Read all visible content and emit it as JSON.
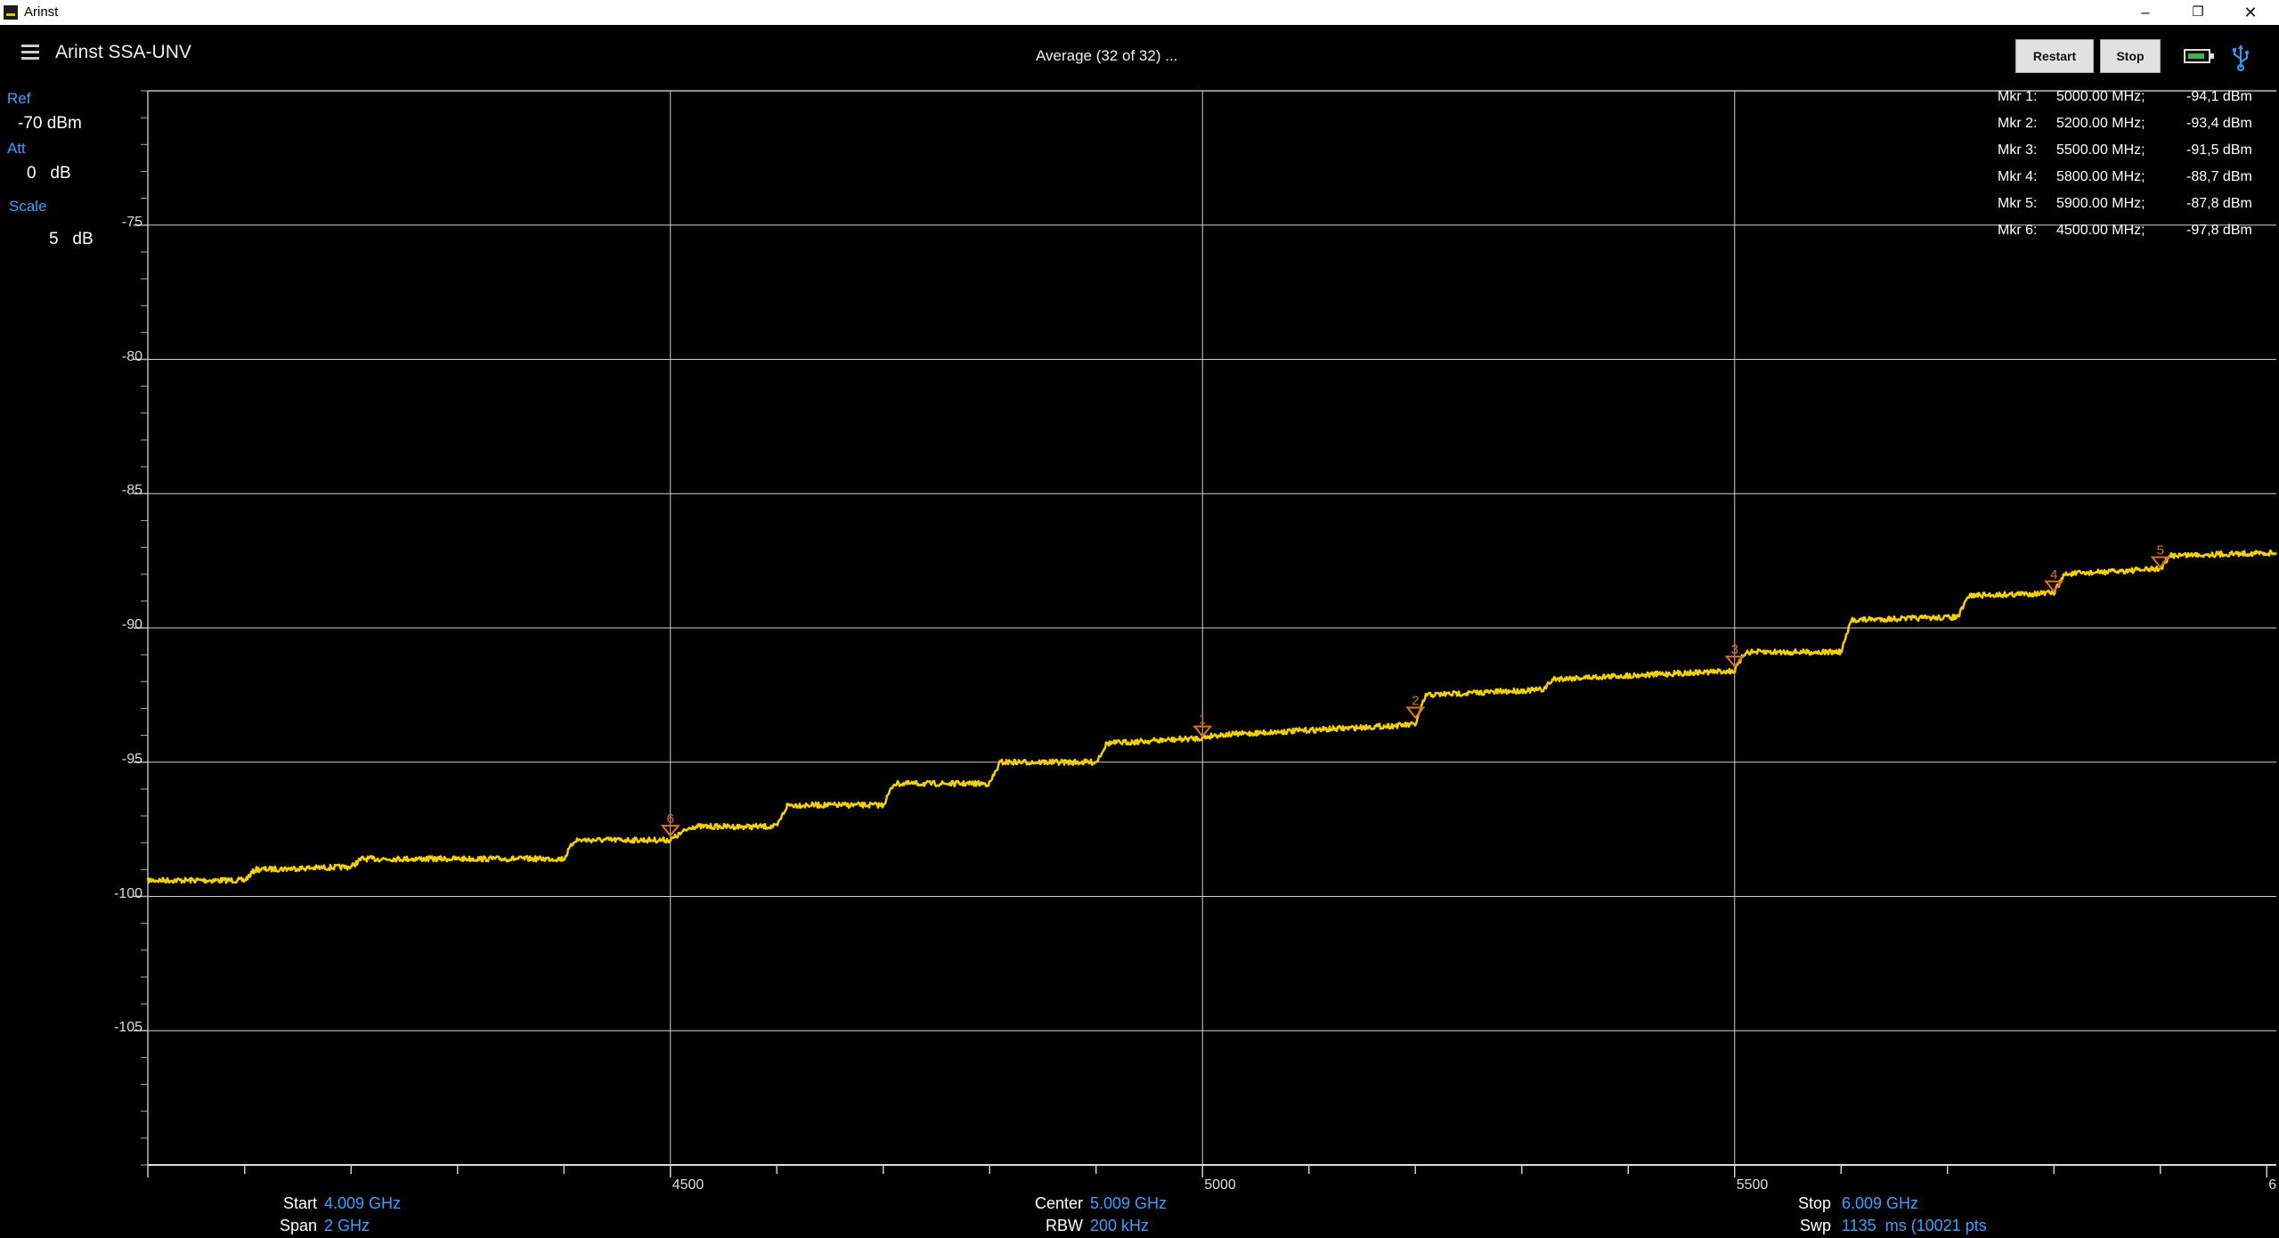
{
  "window": {
    "title": "Arinst",
    "min_glyph": "–",
    "max_glyph": "❐",
    "close_glyph": "✕"
  },
  "header": {
    "app_name": "Arinst SSA-UNV",
    "status": "Average (32 of 32) ...",
    "restart_label": "Restart",
    "stop_label": "Stop"
  },
  "left_panel": {
    "ref_label": "Ref",
    "ref_value": "-70 dBm",
    "att_label": "Att",
    "att_value": "0   dB",
    "scale_label": "Scale",
    "scale_value": "5   dB"
  },
  "markers": [
    {
      "name": "Mkr 1:",
      "freq": "5000.00 MHz;",
      "amp": "-94,1 dBm"
    },
    {
      "name": "Mkr 2:",
      "freq": "5200.00 MHz;",
      "amp": "-93,4 dBm"
    },
    {
      "name": "Mkr 3:",
      "freq": "5500.00 MHz;",
      "amp": "-91,5 dBm"
    },
    {
      "name": "Mkr 4:",
      "freq": "5800.00 MHz;",
      "amp": "-88,7 dBm"
    },
    {
      "name": "Mkr 5:",
      "freq": "5900.00 MHz;",
      "amp": "-87,8 dBm"
    },
    {
      "name": "Mkr 6:",
      "freq": "4500.00 MHz;",
      "amp": "-97,8 dBm"
    }
  ],
  "bottom": {
    "start_label": "Start",
    "start_value": "4.009 GHz",
    "span_label": "Span",
    "span_value": "2 GHz",
    "center_label": "Center",
    "center_value": "5.009 GHz",
    "rbw_label": "RBW",
    "rbw_value": "200 kHz",
    "stop_label": "Stop",
    "stop_value": "6.009 GHz",
    "swp_label": "Swp",
    "swp_value": "1135  ms (10021 pts"
  },
  "chart_data": {
    "type": "line",
    "x_unit": "MHz",
    "y_unit": "dBm",
    "xlim": [
      4009,
      6009
    ],
    "ylim": [
      -110,
      -70
    ],
    "grid": true,
    "trace_color": "#f5d000",
    "marker_color": "#e07020",
    "y_ticks": [
      "-75",
      "-80",
      "-85",
      "-90",
      "-95",
      "-100",
      "-105"
    ],
    "x_ticks": [
      "4500",
      "5000",
      "5500",
      "6"
    ],
    "trace": {
      "x": [
        4009,
        4100,
        4110,
        4200,
        4210,
        4400,
        4410,
        4500,
        4520,
        4600,
        4610,
        4700,
        4710,
        4800,
        4810,
        4900,
        4910,
        5000,
        5010,
        5200,
        5210,
        5320,
        5330,
        5500,
        5510,
        5600,
        5610,
        5710,
        5720,
        5800,
        5810,
        5900,
        5910,
        6009
      ],
      "y": [
        -99.4,
        -99.4,
        -99.0,
        -98.9,
        -98.6,
        -98.6,
        -97.9,
        -97.9,
        -97.4,
        -97.4,
        -96.6,
        -96.6,
        -95.8,
        -95.8,
        -95.0,
        -95.0,
        -94.3,
        -94.1,
        -94.0,
        -93.6,
        -92.5,
        -92.3,
        -91.9,
        -91.6,
        -90.9,
        -90.9,
        -89.7,
        -89.6,
        -88.8,
        -88.7,
        -88.0,
        -87.8,
        -87.3,
        -87.2
      ]
    },
    "markers": [
      {
        "id": "1",
        "x": 5000,
        "y": -94.1
      },
      {
        "id": "2",
        "x": 5200,
        "y": -93.4
      },
      {
        "id": "3",
        "x": 5500,
        "y": -91.5
      },
      {
        "id": "4",
        "x": 5800,
        "y": -88.7
      },
      {
        "id": "5",
        "x": 5900,
        "y": -87.8
      },
      {
        "id": "6",
        "x": 4500,
        "y": -97.8
      }
    ]
  }
}
